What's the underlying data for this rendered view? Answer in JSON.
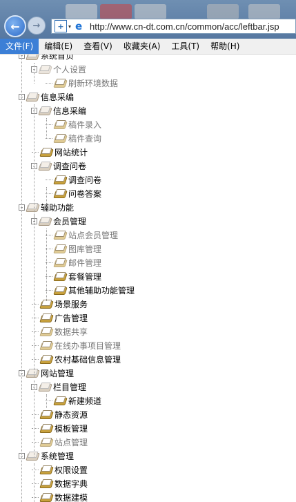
{
  "browser": {
    "url": "http://www.cn-dt.com.cn/common/acc/leftbar.jsp",
    "back_glyph": "←",
    "forward_glyph": "→",
    "plus_glyph": "+",
    "caret_glyph": "▾",
    "ie_glyph": "e"
  },
  "menu": [
    "文件(F)",
    "编辑(E)",
    "查看(V)",
    "收藏夹(A)",
    "工具(T)",
    "帮助(H)"
  ],
  "tree": [
    {
      "label": "系统首页",
      "level": 0,
      "type": "open",
      "toggle": "-",
      "dim": false
    },
    {
      "label": "个人设置",
      "level": 1,
      "type": "open",
      "toggle": "-",
      "dim": true
    },
    {
      "label": "刷新环境数据",
      "level": 2,
      "type": "leaf",
      "dim": true
    },
    {
      "label": "信息采编",
      "level": 0,
      "type": "open",
      "toggle": "-",
      "dim": false
    },
    {
      "label": "信息采编",
      "level": 1,
      "type": "open",
      "toggle": "-",
      "dim": false
    },
    {
      "label": "稿件录入",
      "level": 2,
      "type": "leaf",
      "dim": true
    },
    {
      "label": "稿件查询",
      "level": 2,
      "type": "leaf",
      "dim": true
    },
    {
      "label": "网站统计",
      "level": 1,
      "type": "leaf",
      "dim": false
    },
    {
      "label": "调查问卷",
      "level": 1,
      "type": "open",
      "toggle": "-",
      "dim": false
    },
    {
      "label": "调查问卷",
      "level": 2,
      "type": "leaf",
      "dim": false
    },
    {
      "label": "问卷答案",
      "level": 2,
      "type": "leaf",
      "dim": false
    },
    {
      "label": "辅助功能",
      "level": 0,
      "type": "open",
      "toggle": "-",
      "dim": false
    },
    {
      "label": "会员管理",
      "level": 1,
      "type": "open",
      "toggle": "-",
      "dim": false
    },
    {
      "label": " 站点会员管理",
      "level": 2,
      "type": "leaf",
      "dim": true
    },
    {
      "label": "图库管理",
      "level": 2,
      "type": "leaf",
      "dim": true
    },
    {
      "label": "邮件管理",
      "level": 2,
      "type": "leaf",
      "dim": true
    },
    {
      "label": "套餐管理",
      "level": 2,
      "type": "leaf",
      "dim": false
    },
    {
      "label": "其他辅助功能管理",
      "level": 2,
      "type": "leaf",
      "dim": false
    },
    {
      "label": "场景服务",
      "level": 1,
      "type": "leaf",
      "dim": false
    },
    {
      "label": "广告管理",
      "level": 1,
      "type": "leaf",
      "dim": false
    },
    {
      "label": "数据共享",
      "level": 1,
      "type": "leaf",
      "dim": true
    },
    {
      "label": "在线办事项目管理",
      "level": 1,
      "type": "leaf",
      "dim": true
    },
    {
      "label": "农村基础信息管理",
      "level": 1,
      "type": "leaf",
      "dim": false
    },
    {
      "label": "网站管理",
      "level": 0,
      "type": "open",
      "toggle": "-",
      "dim": false
    },
    {
      "label": "栏目管理",
      "level": 1,
      "type": "open",
      "toggle": "-",
      "dim": false
    },
    {
      "label": "新建频道",
      "level": 2,
      "type": "leaf",
      "dim": false
    },
    {
      "label": "静态资源",
      "level": 1,
      "type": "leaf",
      "dim": false
    },
    {
      "label": "模板管理",
      "level": 1,
      "type": "leaf",
      "dim": false
    },
    {
      "label": "站点管理",
      "level": 1,
      "type": "leaf",
      "dim": true
    },
    {
      "label": "系统管理",
      "level": 0,
      "type": "open",
      "toggle": "-",
      "dim": false
    },
    {
      "label": "权限设置",
      "level": 1,
      "type": "leaf",
      "dim": false
    },
    {
      "label": "数据字典",
      "level": 1,
      "type": "leaf",
      "dim": false
    },
    {
      "label": "数据建模",
      "level": 1,
      "type": "leaf",
      "dim": false
    }
  ]
}
